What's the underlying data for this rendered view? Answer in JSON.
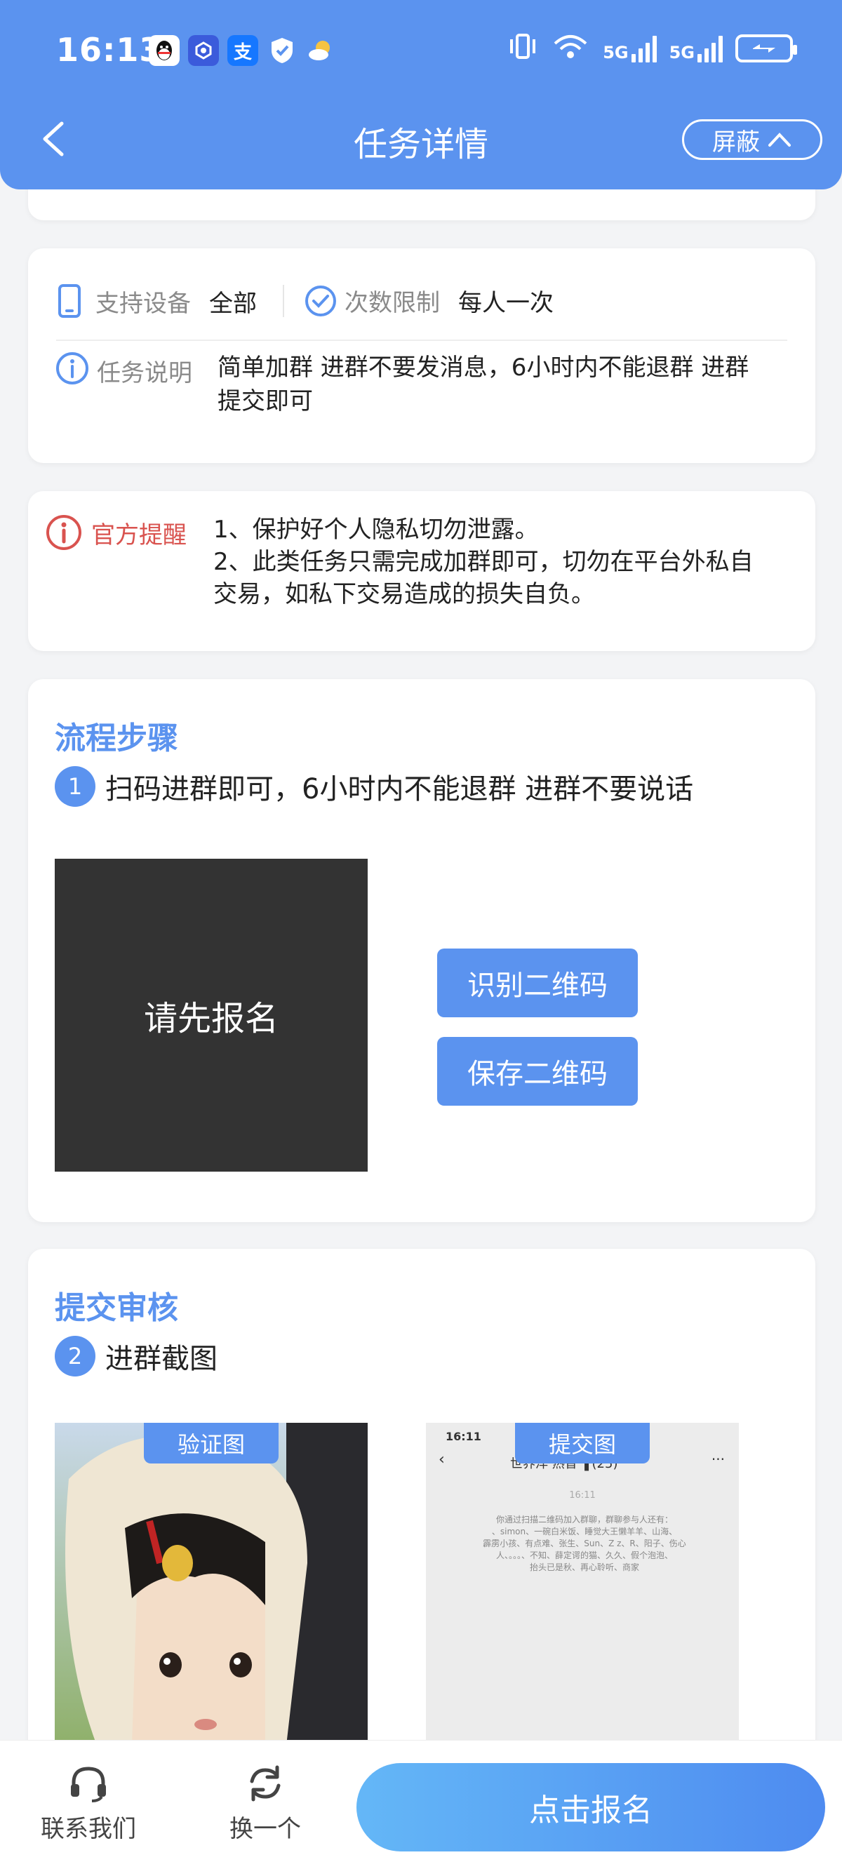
{
  "status_bar": {
    "time": "16:13",
    "network_1": "5G",
    "network_2": "5G",
    "apps": [
      "qq-icon",
      "baidu-icon",
      "alipay-icon",
      "shield-icon",
      "weather-icon"
    ]
  },
  "header": {
    "title": "任务详情",
    "mask_label": "屏蔽"
  },
  "info": {
    "device_label": "支持设备",
    "device_value": "全部",
    "limit_label": "次数限制",
    "limit_value": "每人一次",
    "desc_label": "任务说明",
    "desc_value_line1": "简单加群 进群不要发消息，6小时内不能退群 进群",
    "desc_value_line2": "提交即可"
  },
  "notice": {
    "label": "官方提醒",
    "line1": "1、保护好个人隐私切勿泄露。",
    "line2": "2、此类任务只需完成加群即可，切勿在平台外私自",
    "line3": "交易，如私下交易造成的损失自负。"
  },
  "process": {
    "title": "流程步骤",
    "step_num": "1",
    "step_text": "扫码进群即可，6小时内不能退群 进群不要说话",
    "qr_placeholder": "请先报名",
    "identify_btn": "识别二维码",
    "save_btn": "保存二维码"
  },
  "submit": {
    "title": "提交审核",
    "step_num": "2",
    "step_text": "进群截图",
    "verify_tag": "验证图",
    "submit_tag": "提交图",
    "shot_time": "16:11",
    "shot_title": "世界洋 热音 ❚(25)",
    "shot_date": "16:11",
    "shot_msg_line1": "你通过扫描二维码加入群聊，群聊参与人还有：",
    "shot_msg_line2": "、simon、一碗白米饭、睡觉大王懒羊羊、山海、",
    "shot_msg_line3": "霹雳小孩、有点难、张生、Sun、Z z、R、阳子、伤心",
    "shot_msg_line4": "人、。。。、不知、薛定谔的猫、久久、假个泡泡、",
    "shot_msg_line5": "抬头已是秋、再心聆听、商家"
  },
  "bottom_bar": {
    "contact_label": "联系我们",
    "switch_label": "换一个",
    "signup_label": "点击报名"
  },
  "colors": {
    "primary": "#5b93ef",
    "warning": "#d9534f",
    "background": "#f3f4f6"
  }
}
